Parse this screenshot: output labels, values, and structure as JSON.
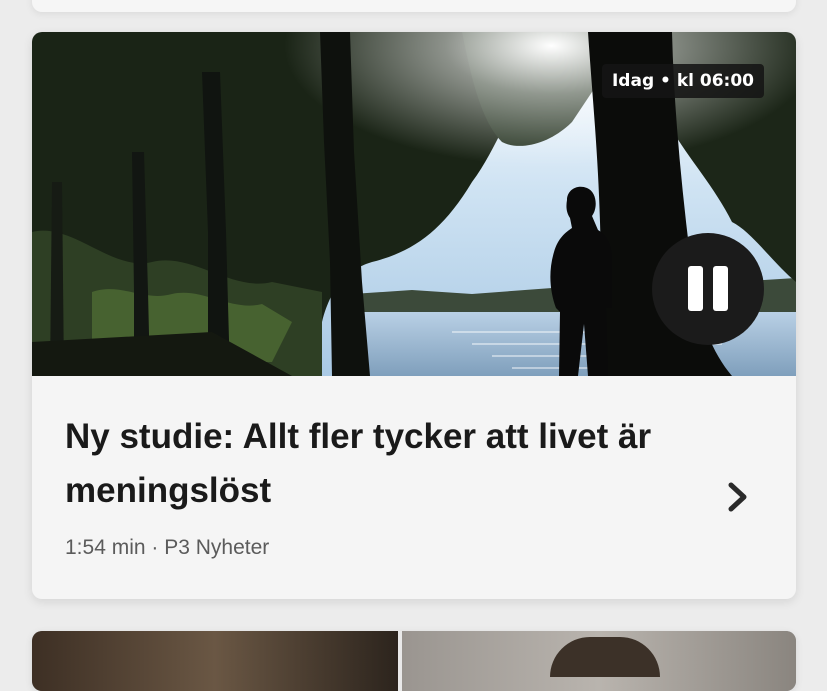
{
  "episode": {
    "timestamp_badge": "Idag • kl 06:00",
    "title": "Ny studie: Allt fler tycker att livet är meningslöst",
    "meta": "1:54 min · P3 Nyheter",
    "player_state": "playing",
    "image_description_icon": "silhouette-by-lake-image"
  },
  "controls": {
    "pause_icon": "pause-icon",
    "open_icon": "chevron-right-icon"
  },
  "colors": {
    "card_background": "#f5f5f5",
    "page_background": "#ececec",
    "title_text": "#1a1a1a",
    "meta_text": "#5b5b5b",
    "play_button": "#1b1b1b"
  }
}
